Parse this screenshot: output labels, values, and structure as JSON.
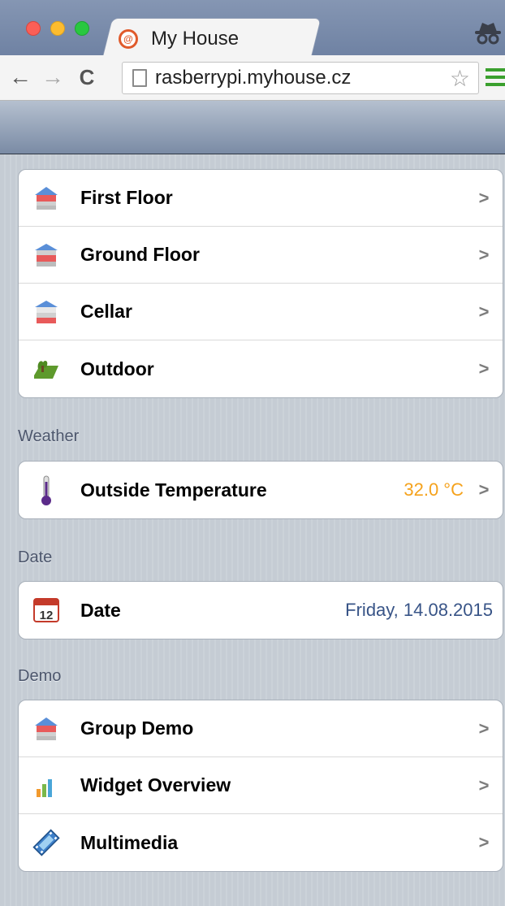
{
  "browser": {
    "tab_title": "My House",
    "url": "rasberrypi.myhouse.cz"
  },
  "groups": [
    {
      "items": [
        {
          "label": "First Floor",
          "icon": "house-floor-icon"
        },
        {
          "label": "Ground Floor",
          "icon": "house-floor-icon"
        },
        {
          "label": "Cellar",
          "icon": "house-cellar-icon"
        },
        {
          "label": "Outdoor",
          "icon": "garden-icon"
        }
      ]
    }
  ],
  "sections": {
    "weather": {
      "title": "Weather",
      "item": {
        "label": "Outside Temperature",
        "value": "32.0 °C",
        "icon": "thermometer-icon"
      }
    },
    "date": {
      "title": "Date",
      "item": {
        "label": "Date",
        "value": "Friday, 14.08.2015",
        "icon": "calendar-icon",
        "calendar_day": "12"
      }
    },
    "demo": {
      "title": "Demo",
      "items": [
        {
          "label": "Group Demo",
          "icon": "house-floor-icon"
        },
        {
          "label": "Widget Overview",
          "icon": "bar-chart-icon"
        },
        {
          "label": "Multimedia",
          "icon": "film-icon"
        }
      ]
    }
  },
  "chevron": ">",
  "colors": {
    "value_orange": "#f5a21c",
    "value_blue": "#385487",
    "section_text": "#4c566c"
  }
}
